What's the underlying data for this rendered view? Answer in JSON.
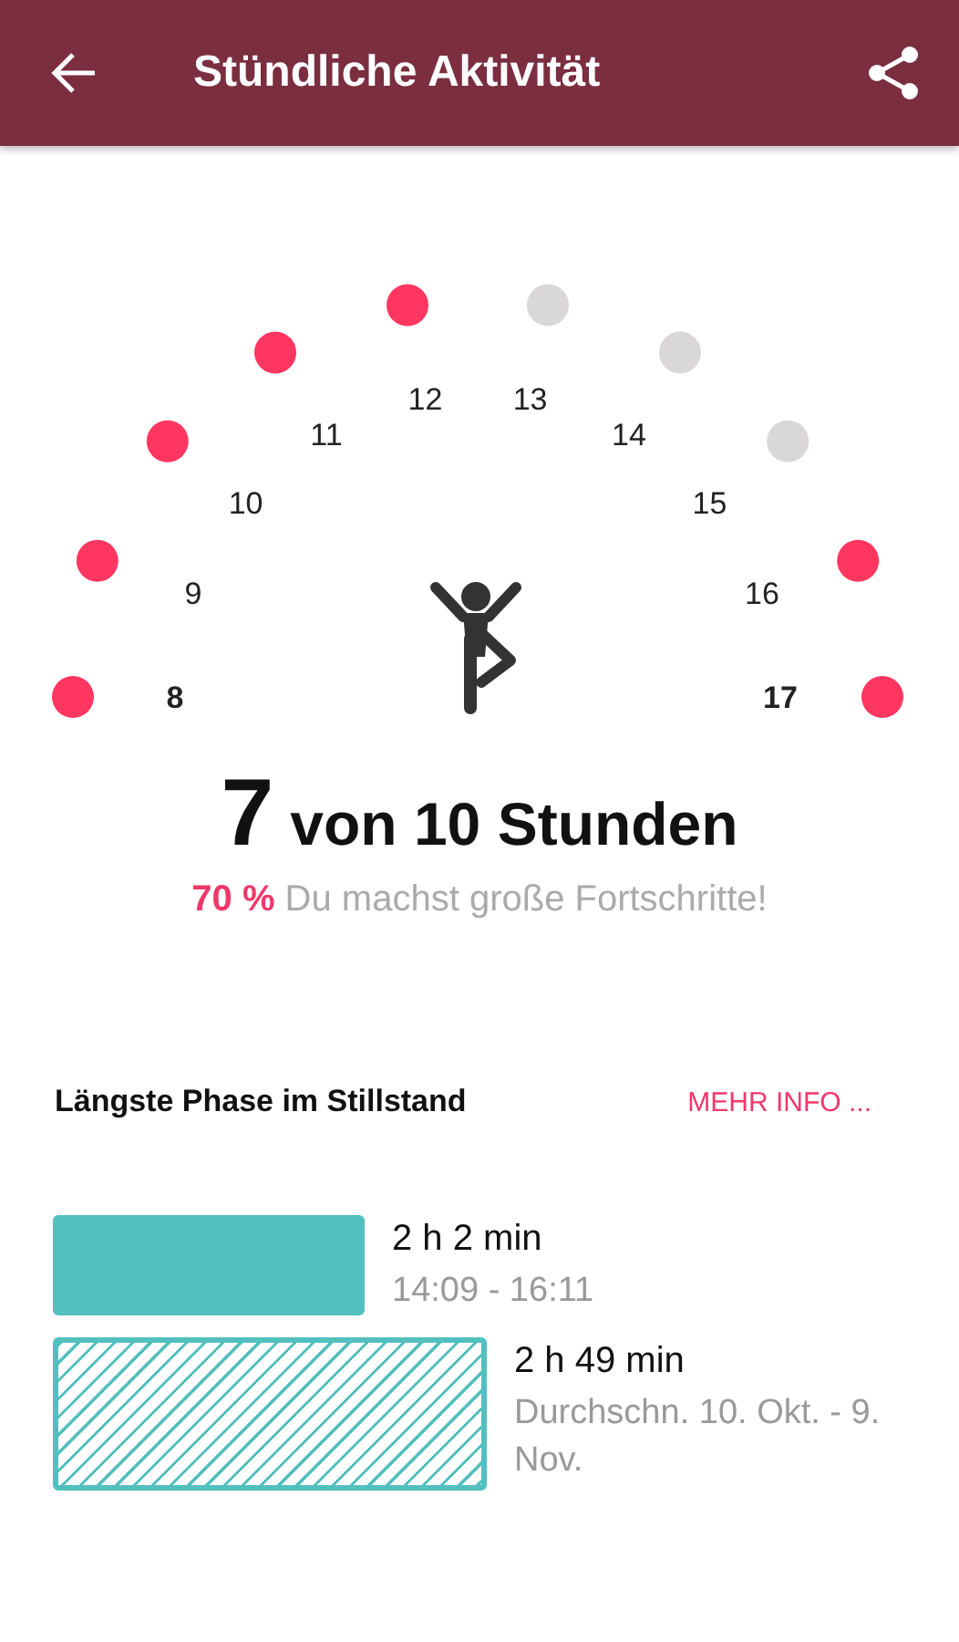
{
  "header": {
    "title": "Stündliche Aktivität"
  },
  "hours": [
    {
      "label": "8",
      "active": true,
      "bold": true
    },
    {
      "label": "9",
      "active": true,
      "bold": false
    },
    {
      "label": "10",
      "active": true,
      "bold": false
    },
    {
      "label": "11",
      "active": true,
      "bold": false
    },
    {
      "label": "12",
      "active": true,
      "bold": false
    },
    {
      "label": "13",
      "active": false,
      "bold": false
    },
    {
      "label": "14",
      "active": false,
      "bold": false
    },
    {
      "label": "15",
      "active": false,
      "bold": false
    },
    {
      "label": "16",
      "active": true,
      "bold": false
    },
    {
      "label": "17",
      "active": true,
      "bold": true
    }
  ],
  "summary": {
    "count": "7",
    "text": "von 10 Stunden",
    "progress": "**70 %** Du machst große Fortschritte!"
  },
  "section": {
    "title": "Längste Phase im Stillstand",
    "link": "MEHR INFO ..."
  },
  "phases": [
    {
      "kind": "today",
      "duration": "2 h 2 min",
      "detail": "14:09 - 16:11"
    },
    {
      "kind": "average",
      "duration": "2 h 49 min",
      "detail": "Durchschn. 10. Okt. - 9. Nov."
    }
  ]
}
